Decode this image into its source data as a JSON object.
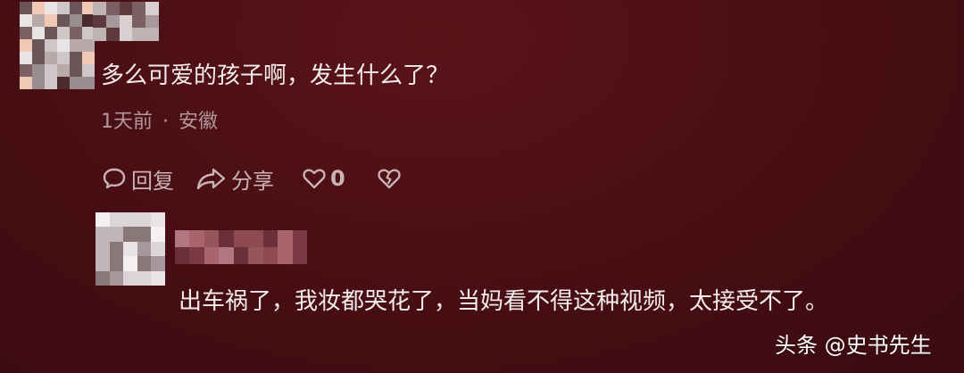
{
  "comment": {
    "text": "多么可爱的孩子啊，发生什么了？",
    "time": "1天前",
    "separator": "·",
    "location": "安徽",
    "actions": {
      "reply_label": "回复",
      "share_label": "分享",
      "like_count": "0"
    }
  },
  "reply": {
    "text": "出车祸了，我妆都哭花了，当妈看不得这种视频，太接受不了。"
  },
  "watermark": {
    "text": "头条 @史书先生"
  },
  "icons": {
    "reply": "speech-bubble-icon",
    "share": "share-arrow-icon",
    "like": "heart-outline-icon",
    "dislike": "broken-heart-icon"
  },
  "colors": {
    "background": "#4a0f14",
    "text": "#f4ecec",
    "meta": "#b3989b",
    "actions": "#c9b3b6"
  }
}
